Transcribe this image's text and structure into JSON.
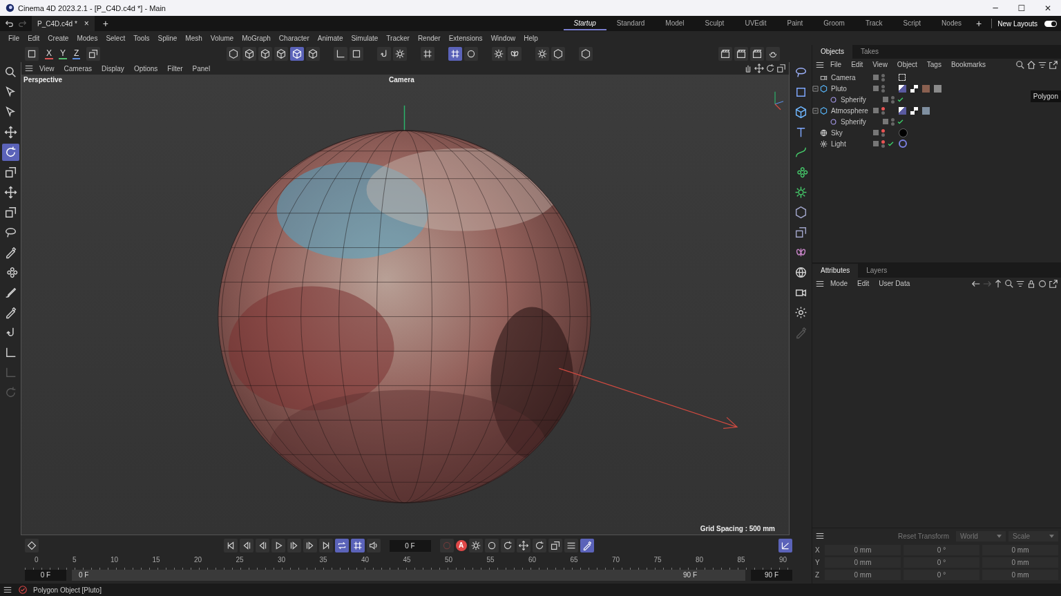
{
  "window": {
    "title": "Cinema 4D 2023.2.1 - [P_C4D.c4d *] - Main",
    "controls": [
      "─",
      "☐",
      "✕"
    ]
  },
  "document_tab": {
    "label": "P_C4D.c4d *",
    "close": "×",
    "add": "+"
  },
  "layouts": [
    {
      "label": "Startup",
      "selected": true
    },
    {
      "label": "Standard",
      "selected": false
    },
    {
      "label": "Model",
      "selected": false
    },
    {
      "label": "Sculpt",
      "selected": false
    },
    {
      "label": "UVEdit",
      "selected": false
    },
    {
      "label": "Paint",
      "selected": false
    },
    {
      "label": "Groom",
      "selected": false
    },
    {
      "label": "Track",
      "selected": false
    },
    {
      "label": "Script",
      "selected": false
    },
    {
      "label": "Nodes",
      "selected": false
    }
  ],
  "layout_add": "+",
  "new_layouts": {
    "label": "New Layouts",
    "on": true
  },
  "menu": [
    "File",
    "Edit",
    "Create",
    "Modes",
    "Select",
    "Tools",
    "Spline",
    "Mesh",
    "Volume",
    "MoGraph",
    "Character",
    "Animate",
    "Simulate",
    "Tracker",
    "Render",
    "Extensions",
    "Window",
    "Help"
  ],
  "axis_toggles": [
    {
      "label": "X",
      "color": "#e05555"
    },
    {
      "label": "Y",
      "color": "#55c070"
    },
    {
      "label": "Z",
      "color": "#5a8ee0"
    }
  ],
  "top_tools": [
    {
      "selected": false
    },
    {
      "selected": false
    },
    {
      "selected": false
    },
    {
      "selected": false
    },
    {
      "selected": false
    },
    {
      "selected": false
    },
    {
      "selected": true
    },
    {
      "selected": false
    },
    {
      "selected": false
    },
    {
      "selected": false
    },
    {
      "selected": false
    },
    {
      "selected": false
    },
    {
      "selected": false
    },
    {
      "selected": true
    },
    {
      "selected": false
    },
    {
      "selected": false
    },
    {
      "selected": false
    },
    {
      "selected": false
    },
    {
      "selected": false
    },
    {
      "selected": false
    },
    {
      "selected": false
    },
    {
      "selected": false
    },
    {
      "selected": false
    },
    {
      "selected": false
    }
  ],
  "left_tools": [
    {
      "selected": false,
      "disabled": false
    },
    {
      "selected": false,
      "disabled": false
    },
    {
      "selected": false,
      "disabled": false
    },
    {
      "selected": false,
      "disabled": false
    },
    {
      "selected": true,
      "disabled": false
    },
    {
      "selected": false,
      "disabled": false
    },
    {
      "selected": false,
      "disabled": false
    },
    {
      "selected": false,
      "disabled": false
    },
    {
      "selected": false,
      "disabled": false
    },
    {
      "selected": false,
      "disabled": false
    },
    {
      "selected": false,
      "disabled": false
    },
    {
      "selected": false,
      "disabled": false
    },
    {
      "selected": false,
      "disabled": false
    },
    {
      "selected": false,
      "disabled": false
    },
    {
      "selected": false,
      "disabled": false
    },
    {
      "selected": false,
      "disabled": true
    },
    {
      "selected": false,
      "disabled": true
    }
  ],
  "right_tools": [
    {
      "selected": false,
      "disabled": false
    },
    {
      "selected": false,
      "disabled": false
    },
    {
      "selected": false,
      "disabled": false
    },
    {
      "selected": false,
      "disabled": false
    },
    {
      "selected": false,
      "disabled": false
    },
    {
      "selected": false,
      "disabled": false
    },
    {
      "selected": false,
      "disabled": false
    },
    {
      "selected": false,
      "disabled": false
    },
    {
      "selected": false,
      "disabled": false
    },
    {
      "selected": false,
      "disabled": false
    },
    {
      "selected": false,
      "disabled": false
    },
    {
      "selected": false,
      "disabled": false
    },
    {
      "selected": false,
      "disabled": false
    },
    {
      "selected": false,
      "disabled": true
    }
  ],
  "viewport": {
    "menu": [
      "View",
      "Cameras",
      "Display",
      "Options",
      "Filter",
      "Panel"
    ],
    "label": "Perspective",
    "camera": "Camera",
    "grid_spacing": "Grid Spacing : 500 mm"
  },
  "timeline": {
    "controls": [
      {
        "selected": false
      },
      {
        "selected": false
      },
      {
        "selected": false
      },
      {
        "selected": false
      },
      {
        "selected": false
      },
      {
        "selected": false
      },
      {
        "selected": false
      },
      {
        "selected": true
      },
      {
        "selected": true
      },
      {
        "selected": false
      }
    ],
    "frame": "0 F",
    "autokey": "A",
    "extra_controls": [
      {
        "selected": false
      },
      {
        "selected": false
      },
      {
        "selected": false
      },
      {
        "selected": false
      },
      {
        "selected": false
      },
      {
        "selected": false
      },
      {
        "selected": false
      },
      {
        "selected": true
      }
    ],
    "ticks": [
      "0",
      "5",
      "10",
      "15",
      "20",
      "25",
      "30",
      "35",
      "40",
      "45",
      "50",
      "55",
      "60",
      "65",
      "70",
      "75",
      "80",
      "85",
      "90"
    ],
    "range": [
      "0 F",
      "0 F",
      "90 F",
      "90 F"
    ],
    "range_bar": {
      "level": 1
    }
  },
  "status_bar": {
    "text": "Polygon Object [Pluto]"
  },
  "objects_panel": {
    "tabs": [
      {
        "label": "Objects",
        "selected": true
      },
      {
        "label": "Takes",
        "selected": false
      }
    ],
    "menu": [
      "File",
      "Edit",
      "View",
      "Object",
      "Tags",
      "Bookmarks"
    ],
    "objects": [
      {
        "name": "Camera",
        "kind": "camera",
        "editor_hidden": false,
        "enabled": false,
        "tags": [
          {
            "kind": "target"
          }
        ]
      },
      {
        "name": "Pluto",
        "kind": "polygon",
        "editor_hidden": false,
        "enabled": false,
        "expanded": true,
        "tags": [
          {
            "kind": "phong"
          },
          {
            "kind": "checker"
          },
          {
            "kind": "texture"
          },
          {
            "kind": "texture-grey"
          }
        ],
        "children": [
          {
            "name": "Spherify",
            "kind": "deformer",
            "editor_hidden": false,
            "enabled": true
          }
        ]
      },
      {
        "name": "Atmosphere",
        "kind": "polygon",
        "editor_hidden": true,
        "enabled": false,
        "expanded": true,
        "tags": [
          {
            "kind": "phong"
          },
          {
            "kind": "checker"
          },
          {
            "kind": "texture-noise"
          }
        ],
        "children": [
          {
            "name": "Spherify",
            "kind": "deformer",
            "editor_hidden": false,
            "enabled": true
          }
        ]
      },
      {
        "name": "Sky",
        "kind": "sky",
        "editor_hidden": true,
        "enabled": false,
        "tags": [
          {
            "kind": "sky-material"
          }
        ]
      },
      {
        "name": "Light",
        "kind": "light",
        "editor_hidden": true,
        "enabled": true,
        "tags": [
          {
            "kind": "light-target"
          }
        ]
      }
    ],
    "tooltip": "Polygon"
  },
  "attributes_panel": {
    "tabs": [
      {
        "label": "Attributes",
        "selected": true
      },
      {
        "label": "Layers",
        "selected": false
      }
    ],
    "menu": [
      "Mode",
      "Edit",
      "User Data"
    ]
  },
  "coordinates": {
    "button": "Reset Transform",
    "dropdowns": [
      "World",
      "Scale"
    ],
    "rows": [
      {
        "axis": "X",
        "values": [
          "0 mm",
          "0 °",
          "0 mm"
        ]
      },
      {
        "axis": "Y",
        "values": [
          "0 mm",
          "0 °",
          "0 mm"
        ]
      },
      {
        "axis": "Z",
        "values": [
          "0 mm",
          "0 °",
          "0 mm"
        ]
      }
    ]
  }
}
